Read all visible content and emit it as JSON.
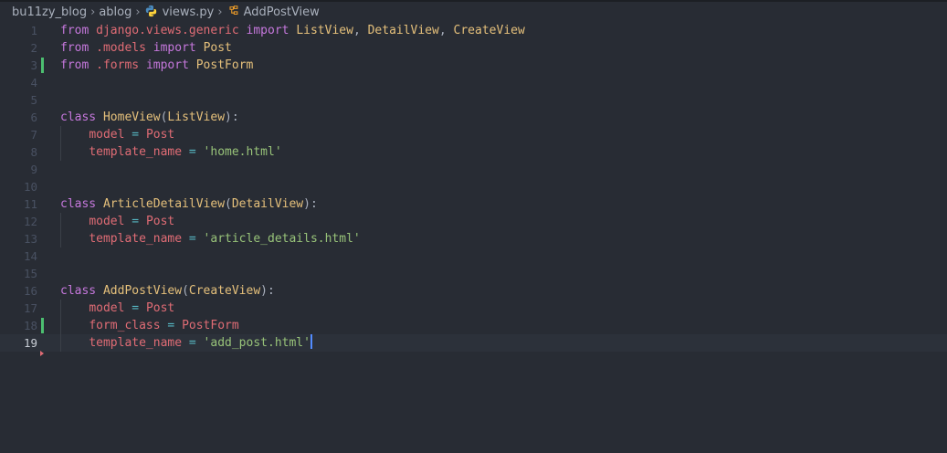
{
  "breadcrumb": {
    "items": [
      "bu11zy_blog",
      "ablog",
      "views.py",
      "AddPostView"
    ],
    "separator": "›"
  },
  "editor": {
    "current_line": 19,
    "modified_lines": [
      3,
      18
    ],
    "lines": [
      {
        "n": "1",
        "tokens": [
          [
            "kw",
            "from"
          ],
          [
            "pl",
            " "
          ],
          [
            "mod",
            "django.views.generic"
          ],
          [
            "pl",
            " "
          ],
          [
            "kw",
            "import"
          ],
          [
            "pl",
            " "
          ],
          [
            "cls",
            "ListView"
          ],
          [
            "pl",
            ", "
          ],
          [
            "cls",
            "DetailView"
          ],
          [
            "pl",
            ", "
          ],
          [
            "cls",
            "CreateView"
          ]
        ]
      },
      {
        "n": "2",
        "tokens": [
          [
            "kw",
            "from"
          ],
          [
            "pl",
            " "
          ],
          [
            "mod",
            ".models"
          ],
          [
            "pl",
            " "
          ],
          [
            "kw",
            "import"
          ],
          [
            "pl",
            " "
          ],
          [
            "cls",
            "Post"
          ]
        ]
      },
      {
        "n": "3",
        "tokens": [
          [
            "kw",
            "from"
          ],
          [
            "pl",
            " "
          ],
          [
            "mod",
            ".forms"
          ],
          [
            "pl",
            " "
          ],
          [
            "kw",
            "import"
          ],
          [
            "pl",
            " "
          ],
          [
            "cls",
            "PostForm"
          ]
        ]
      },
      {
        "n": "4",
        "tokens": []
      },
      {
        "n": "5",
        "tokens": []
      },
      {
        "n": "6",
        "tokens": [
          [
            "kw",
            "class"
          ],
          [
            "pl",
            " "
          ],
          [
            "cls",
            "HomeView"
          ],
          [
            "pl",
            "("
          ],
          [
            "cls",
            "ListView"
          ],
          [
            "pl",
            "):"
          ]
        ]
      },
      {
        "n": "7",
        "tokens": [
          [
            "pl",
            "    "
          ],
          [
            "var",
            "model"
          ],
          [
            "pl",
            " "
          ],
          [
            "op",
            "="
          ],
          [
            "pl",
            " "
          ],
          [
            "var",
            "Post"
          ]
        ]
      },
      {
        "n": "8",
        "tokens": [
          [
            "pl",
            "    "
          ],
          [
            "var",
            "template_name"
          ],
          [
            "pl",
            " "
          ],
          [
            "op",
            "="
          ],
          [
            "pl",
            " "
          ],
          [
            "str",
            "'home.html'"
          ]
        ]
      },
      {
        "n": "9",
        "tokens": []
      },
      {
        "n": "10",
        "tokens": []
      },
      {
        "n": "11",
        "tokens": [
          [
            "kw",
            "class"
          ],
          [
            "pl",
            " "
          ],
          [
            "cls",
            "ArticleDetailView"
          ],
          [
            "pl",
            "("
          ],
          [
            "cls",
            "DetailView"
          ],
          [
            "pl",
            "):"
          ]
        ]
      },
      {
        "n": "12",
        "tokens": [
          [
            "pl",
            "    "
          ],
          [
            "var",
            "model"
          ],
          [
            "pl",
            " "
          ],
          [
            "op",
            "="
          ],
          [
            "pl",
            " "
          ],
          [
            "var",
            "Post"
          ]
        ]
      },
      {
        "n": "13",
        "tokens": [
          [
            "pl",
            "    "
          ],
          [
            "var",
            "template_name"
          ],
          [
            "pl",
            " "
          ],
          [
            "op",
            "="
          ],
          [
            "pl",
            " "
          ],
          [
            "str",
            "'article_details.html'"
          ]
        ]
      },
      {
        "n": "14",
        "tokens": []
      },
      {
        "n": "15",
        "tokens": []
      },
      {
        "n": "16",
        "tokens": [
          [
            "kw",
            "class"
          ],
          [
            "pl",
            " "
          ],
          [
            "cls",
            "AddPostView"
          ],
          [
            "pl",
            "("
          ],
          [
            "cls",
            "CreateView"
          ],
          [
            "pl",
            "):"
          ]
        ]
      },
      {
        "n": "17",
        "tokens": [
          [
            "pl",
            "    "
          ],
          [
            "var",
            "model"
          ],
          [
            "pl",
            " "
          ],
          [
            "op",
            "="
          ],
          [
            "pl",
            " "
          ],
          [
            "var",
            "Post"
          ]
        ]
      },
      {
        "n": "18",
        "tokens": [
          [
            "pl",
            "    "
          ],
          [
            "var",
            "form_class"
          ],
          [
            "pl",
            " "
          ],
          [
            "op",
            "="
          ],
          [
            "pl",
            " "
          ],
          [
            "var",
            "PostForm"
          ]
        ]
      },
      {
        "n": "19",
        "tokens": [
          [
            "pl",
            "    "
          ],
          [
            "var",
            "template_name"
          ],
          [
            "pl",
            " "
          ],
          [
            "op",
            "="
          ],
          [
            "pl",
            " "
          ],
          [
            "str",
            "'add_post.html'"
          ]
        ]
      }
    ]
  },
  "colors": {
    "background": "#282c34",
    "keyword": "#c678dd",
    "class": "#e5c07b",
    "string": "#98c379",
    "variable": "#e06c75",
    "operator": "#56b6c2",
    "modified_gutter": "#4cbf70",
    "caret": "#528bff"
  },
  "icons": {
    "file": "python-icon",
    "symbol": "symbol-class-icon"
  }
}
